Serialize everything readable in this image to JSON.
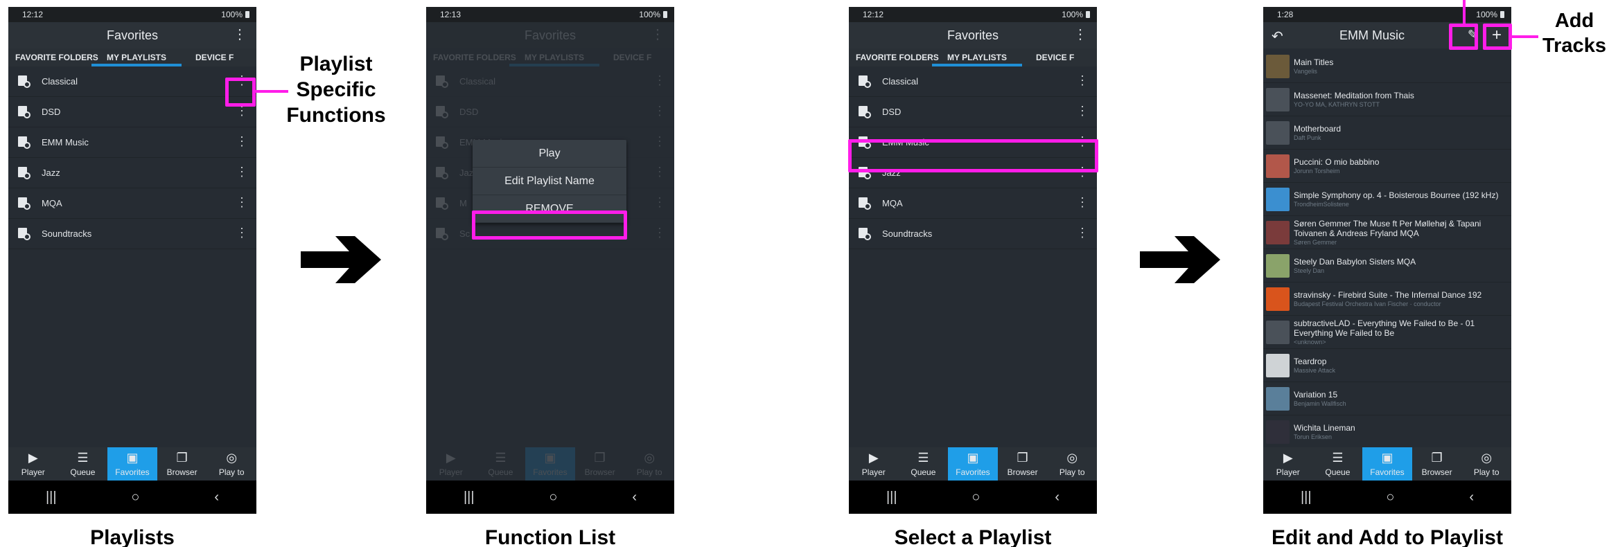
{
  "callouts": {
    "playlist_functions": [
      "Playlist",
      "Specific",
      "Functions"
    ],
    "add_tracks": [
      "Add",
      "Tracks"
    ]
  },
  "captions": [
    "Playlists",
    "Function List",
    "Select a Playlist",
    "Edit and Add to Playlist"
  ],
  "phones": [
    {
      "time": "12:12",
      "battery": "100%"
    },
    {
      "time": "12:13",
      "battery": "100%"
    },
    {
      "time": "12:12",
      "battery": "100%"
    },
    {
      "time": "1:28",
      "battery": "100%"
    }
  ],
  "favorites": {
    "title": "Favorites",
    "tabs": [
      "FAVORITE FOLDERS",
      "MY PLAYLISTS",
      "DEVICE F"
    ],
    "playlists": [
      "Classical",
      "DSD",
      "EMM Music",
      "Jazz",
      "MQA",
      "Soundtracks"
    ],
    "menu_playlists": [
      "Classical",
      "DSD",
      "EMM Music",
      "Jazz",
      "M",
      "Sc"
    ]
  },
  "function_menu": [
    "Play",
    "Edit Playlist Name",
    "REMOVE"
  ],
  "playlist_view": {
    "title": "EMM Music",
    "tracks": [
      {
        "title": "Main Titles",
        "artist": "Vangelis",
        "art": "#6b5a3a"
      },
      {
        "title": "Massenet: Meditation from Thais",
        "artist": "YO-YO MA, KATHRYN STOTT",
        "art": "#4a5159"
      },
      {
        "title": "Motherboard",
        "artist": "Daft Punk",
        "art": "#4a5159"
      },
      {
        "title": "Puccini: O mio babbino",
        "artist": "Jorunn Torsheim",
        "art": "#b2574a"
      },
      {
        "title": "Simple Symphony  op. 4 - Boisterous Bourree (192 kHz)",
        "artist": "TrondheimSolistene",
        "art": "#3b8fd0"
      },
      {
        "title": "Søren Gemmer The Muse ft Per Møllehøj & Tapani Toivanen & Andreas Fryland MQA",
        "artist": "Søren Gemmer",
        "art": "#7a3b3b"
      },
      {
        "title": "Steely Dan Babylon Sisters MQA",
        "artist": "Steely Dan",
        "art": "#8aa36a"
      },
      {
        "title": "stravinsky - Firebird Suite - The Infernal Dance 192",
        "artist": "Budapest Festival Orchestra Ivan Fischer · conductor",
        "art": "#d9541c"
      },
      {
        "title": "subtractiveLAD - Everything We Failed to Be - 01 Everything We Failed to Be",
        "artist": "<unknown>",
        "art": "#4a5159"
      },
      {
        "title": "Teardrop",
        "artist": "Massive Attack",
        "art": "#cfd3d6"
      },
      {
        "title": "Variation 15",
        "artist": "Benjamin Wallfisch",
        "art": "#5a7f9a"
      },
      {
        "title": "Wichita Lineman",
        "artist": "Torun Eriksen",
        "art": "#2f2f3a"
      }
    ]
  },
  "bottom_nav": [
    "Player",
    "Queue",
    "Favorites",
    "Browser",
    "Play to"
  ],
  "colors": {
    "highlight": "#ff1de9",
    "accent": "#1f9ee8",
    "tab_underline": "#1f8fd6"
  }
}
